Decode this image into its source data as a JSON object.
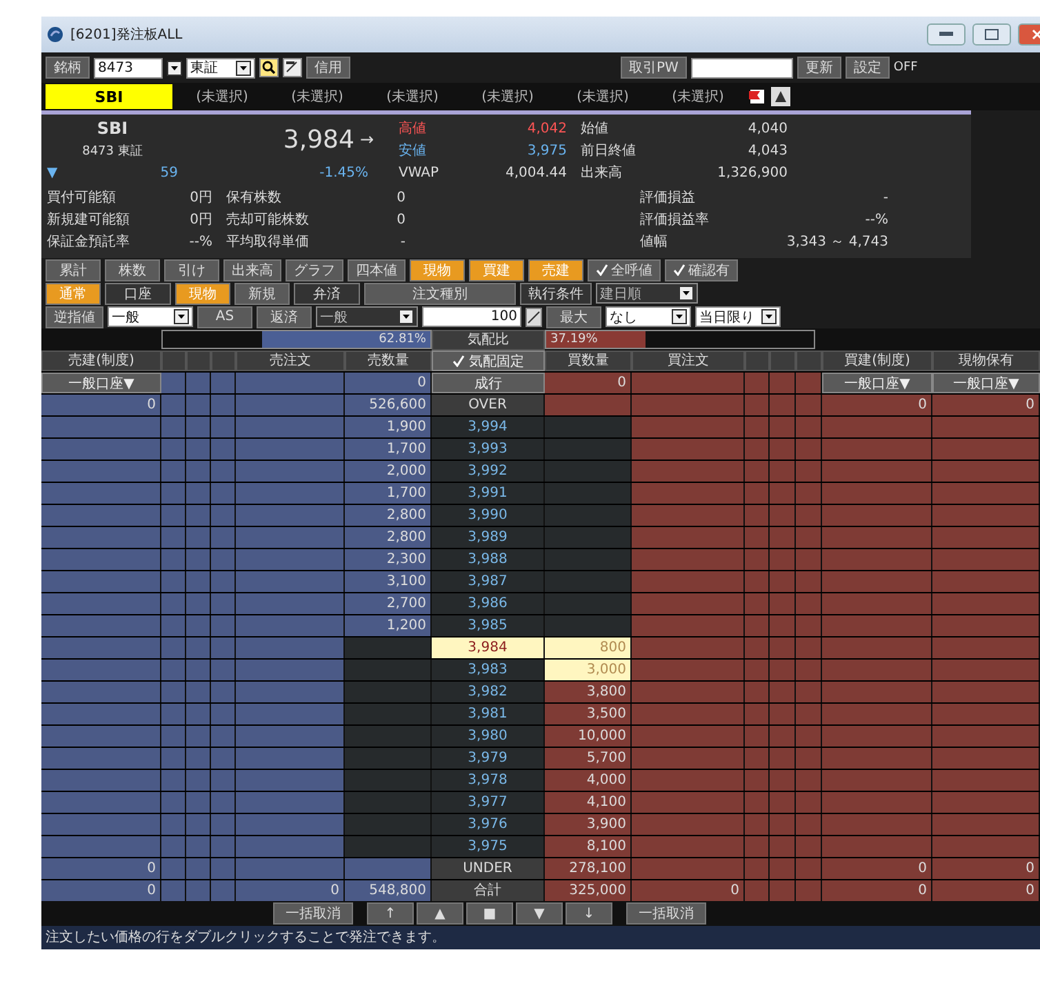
{
  "window": {
    "title": "[6201]発注板ALL"
  },
  "toolbar": {
    "symbol_button": "銘柄",
    "symbol_value": "8473",
    "market_value": "東証",
    "margin_button": "信用",
    "password_label": "取引PW",
    "refresh_button": "更新",
    "settings_button": "設定",
    "status": "OFF"
  },
  "tabs": [
    {
      "label": "SBI",
      "selected": true
    },
    {
      "label": "(未選択)",
      "selected": false
    },
    {
      "label": "(未選択)",
      "selected": false
    },
    {
      "label": "(未選択)",
      "selected": false
    },
    {
      "label": "(未選択)",
      "selected": false
    },
    {
      "label": "(未選択)",
      "selected": false
    },
    {
      "label": "(未選択)",
      "selected": false
    }
  ],
  "quote": {
    "name": "SBI",
    "code": "8473 東証",
    "price": "3,984",
    "trend": "→",
    "change_mark": "▼",
    "change": "59",
    "change_rate": "-1.45%",
    "market": [
      [
        {
          "label": "高値",
          "value": "4,042",
          "kind": "high"
        },
        {
          "label": "始値",
          "value": "4,040",
          "kind": "plain"
        }
      ],
      [
        {
          "label": "安値",
          "value": "3,975",
          "kind": "low"
        },
        {
          "label": "前日終値",
          "value": "4,043",
          "kind": "plain"
        }
      ],
      [
        {
          "label": "VWAP",
          "value": "4,004.44",
          "kind": "plain"
        },
        {
          "label": "出来高",
          "value": "1,326,900",
          "kind": "plain"
        }
      ]
    ],
    "account": [
      [
        {
          "label": "買付可能額",
          "value": "0円"
        },
        {
          "label": "保有株数",
          "value": "0"
        },
        {
          "label": "評価損益",
          "value": "-"
        }
      ],
      [
        {
          "label": "新規建可能額",
          "value": "0円"
        },
        {
          "label": "売却可能株数",
          "value": "0"
        },
        {
          "label": "評価損益率",
          "value": "--%"
        }
      ],
      [
        {
          "label": "保証金預託率",
          "value": "--%"
        },
        {
          "label": "平均取得単価",
          "value": "-"
        },
        {
          "label": "値幅",
          "value": "3,343 ～ 4,743"
        }
      ]
    ]
  },
  "control_rows": [
    [
      {
        "kind": "toggle",
        "label": "累計",
        "selected": false
      },
      {
        "kind": "toggle",
        "label": "株数",
        "selected": false
      },
      {
        "kind": "toggle",
        "label": "引け",
        "selected": false
      },
      {
        "kind": "toggle",
        "label": "出来高",
        "selected": false
      },
      {
        "kind": "toggle",
        "label": "グラフ",
        "selected": false
      },
      {
        "kind": "toggle",
        "label": "四本値",
        "selected": false
      },
      {
        "kind": "toggle",
        "label": "現物",
        "selected": true
      },
      {
        "kind": "toggle",
        "label": "買建",
        "selected": true
      },
      {
        "kind": "toggle",
        "label": "売建",
        "selected": true
      },
      {
        "kind": "check",
        "label": "全呼値",
        "checked": true
      },
      {
        "kind": "check",
        "label": "確認有",
        "checked": true
      }
    ],
    [
      {
        "kind": "toggle",
        "label": "通常",
        "selected": true
      },
      {
        "kind": "label",
        "label": "口座"
      },
      {
        "kind": "toggle",
        "label": "現物",
        "selected": true
      },
      {
        "kind": "toggle",
        "label": "新規",
        "selected": false
      },
      {
        "kind": "label",
        "label": "弁済"
      },
      {
        "kind": "wide",
        "label": "注文種別"
      },
      {
        "kind": "label",
        "label": "執行条件"
      },
      {
        "kind": "select",
        "value": "建日順",
        "disabled": true
      }
    ],
    [
      {
        "kind": "toggle",
        "label": "逆指値",
        "selected": false
      },
      {
        "kind": "select",
        "value": "一般",
        "disabled": false
      },
      {
        "kind": "toggle",
        "label": "AS",
        "selected": false
      },
      {
        "kind": "toggle",
        "label": "返済",
        "selected": false
      },
      {
        "kind": "select",
        "value": "一般",
        "disabled": true
      },
      {
        "kind": "input",
        "value": "100"
      },
      {
        "kind": "toggle",
        "label": "最大",
        "selected": false
      },
      {
        "kind": "select",
        "value": "なし",
        "disabled": false
      },
      {
        "kind": "select",
        "value": "当日限り",
        "disabled": false
      }
    ]
  ],
  "ratio": {
    "sell": {
      "text": "62.81%",
      "level": 0.6281
    },
    "label": "気配比",
    "buy": {
      "text": "37.19%",
      "level": 0.3719
    }
  },
  "board": {
    "headers": {
      "sell_build": "売建(制度)",
      "sell_order": "売注文",
      "sell_qty": "売数量",
      "price": {
        "label": "気配固定",
        "checked": true
      },
      "buy_qty": "買数量",
      "buy_order": "買注文",
      "buy_build": "買建(制度)",
      "spot": "現物保有"
    },
    "rows": [
      {
        "kind": "account",
        "sell_build": "一般口座▼",
        "sell_qty": "0",
        "price": "成行",
        "buy_qty": "0",
        "buy_build": "一般口座▼",
        "spot": "一般口座▼"
      },
      {
        "kind": "over",
        "sell_build": "0",
        "sell_qty": "526,600",
        "price": "OVER",
        "buy_build": "0",
        "spot": "0"
      },
      {
        "kind": "ask",
        "sell_qty": "1,900",
        "price": "3,994",
        "price_marked": false
      },
      {
        "kind": "ask",
        "sell_qty": "1,700",
        "price": "3,993",
        "price_marked": false
      },
      {
        "kind": "ask",
        "sell_qty": "2,000",
        "price": "3,992",
        "price_marked": false
      },
      {
        "kind": "ask",
        "sell_qty": "1,700",
        "price": "3,991",
        "price_marked": false
      },
      {
        "kind": "ask",
        "sell_qty": "2,800",
        "price": "3,990",
        "price_marked": false
      },
      {
        "kind": "ask",
        "sell_qty": "2,800",
        "price": "3,989",
        "price_marked": false
      },
      {
        "kind": "ask",
        "sell_qty": "2,300",
        "price": "3,988",
        "price_marked": false
      },
      {
        "kind": "ask",
        "sell_qty": "3,100",
        "price": "3,987",
        "price_marked": false
      },
      {
        "kind": "ask",
        "sell_qty": "2,700",
        "price": "3,986",
        "price_marked": false
      },
      {
        "kind": "ask",
        "sell_qty": "1,200",
        "price": "3,985",
        "price_marked": false
      },
      {
        "kind": "bid",
        "price": "3,984",
        "buy_qty": "800",
        "price_marked": true,
        "qty_marked": true
      },
      {
        "kind": "bid",
        "price": "3,983",
        "buy_qty": "3,000",
        "price_marked": false,
        "qty_marked": true
      },
      {
        "kind": "bid",
        "price": "3,982",
        "buy_qty": "3,800",
        "price_marked": false,
        "qty_marked": false
      },
      {
        "kind": "bid",
        "price": "3,981",
        "buy_qty": "3,500",
        "price_marked": false,
        "qty_marked": false
      },
      {
        "kind": "bid",
        "price": "3,980",
        "buy_qty": "10,000",
        "price_marked": false,
        "qty_marked": false
      },
      {
        "kind": "bid",
        "price": "3,979",
        "buy_qty": "5,700",
        "price_marked": false,
        "qty_marked": false
      },
      {
        "kind": "bid",
        "price": "3,978",
        "buy_qty": "4,000",
        "price_marked": false,
        "qty_marked": false
      },
      {
        "kind": "bid",
        "price": "3,977",
        "buy_qty": "4,100",
        "price_marked": false,
        "qty_marked": false
      },
      {
        "kind": "bid",
        "price": "3,976",
        "buy_qty": "3,900",
        "price_marked": false,
        "qty_marked": false
      },
      {
        "kind": "bid",
        "price": "3,975",
        "buy_qty": "8,100",
        "price_marked": false,
        "qty_marked": false
      },
      {
        "kind": "under",
        "sell_build": "0",
        "price": "UNDER",
        "buy_qty": "278,100",
        "buy_build": "0",
        "spot": "0"
      },
      {
        "kind": "total",
        "sell_build": "0",
        "sell_order": "0",
        "sell_qty": "548,800",
        "price": "合計",
        "buy_qty": "325,000",
        "buy_order": "0",
        "buy_build": "0",
        "spot": "0"
      }
    ]
  },
  "footer_buttons": [
    {
      "kind": "cancel",
      "label": "一括取消"
    },
    {
      "kind": "nav",
      "label": "↑"
    },
    {
      "kind": "nav",
      "label": "▲"
    },
    {
      "kind": "nav",
      "label": "■"
    },
    {
      "kind": "nav",
      "label": "▼"
    },
    {
      "kind": "nav",
      "label": "↓"
    },
    {
      "kind": "cancel",
      "label": "一括取消"
    }
  ],
  "status_bar": "注文したい価格の行をダブルクリックすることで発注できます。"
}
